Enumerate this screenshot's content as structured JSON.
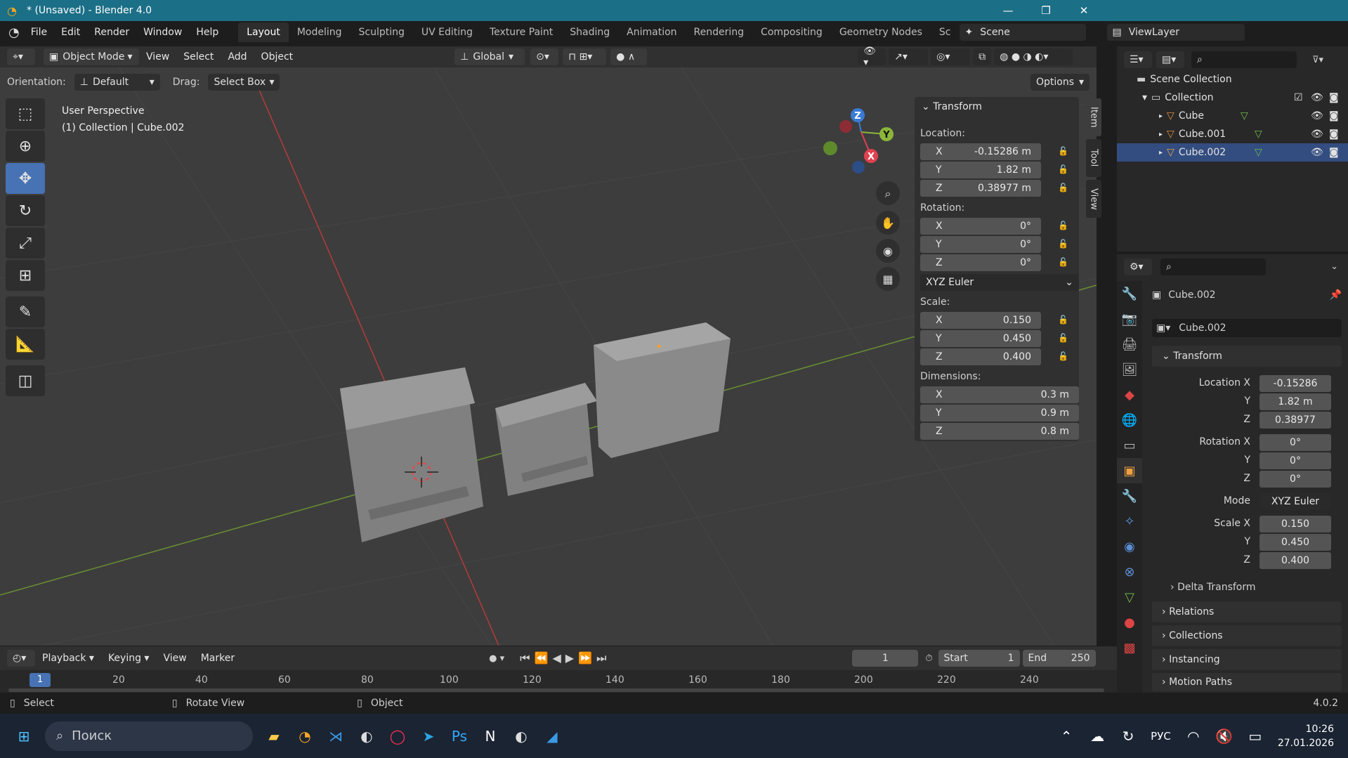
{
  "window": {
    "title": "* (Unsaved) - Blender 4.0",
    "minimize": "—",
    "maximize": "❐",
    "close": "✕"
  },
  "menu": [
    "File",
    "Edit",
    "Render",
    "Window",
    "Help"
  ],
  "workspaces": [
    "Layout",
    "Modeling",
    "Sculpting",
    "UV Editing",
    "Texture Paint",
    "Shading",
    "Animation",
    "Rendering",
    "Compositing",
    "Geometry Nodes",
    "Sc"
  ],
  "scene": {
    "name": "Scene",
    "view_layer": "ViewLayer"
  },
  "viewport_header": {
    "mode": "Object Mode",
    "view": "View",
    "select": "Select",
    "add": "Add",
    "object": "Object",
    "transform_orientation": "Global"
  },
  "tool_settings": {
    "orientation_label": "Orientation:",
    "orientation": "Default",
    "drag_label": "Drag:",
    "drag": "Select Box",
    "options": "Options"
  },
  "viewport_info": {
    "line1": "User Perspective",
    "line2": "(1) Collection | Cube.002"
  },
  "gizmo": {
    "x": "X",
    "y": "Y",
    "z": "Z"
  },
  "npanel": {
    "title": "Transform",
    "location_label": "Location:",
    "location": {
      "x": "-0.15286 m",
      "y": "1.82 m",
      "z": "0.38977 m"
    },
    "rotation_label": "Rotation:",
    "rotation": {
      "x": "0°",
      "y": "0°",
      "z": "0°"
    },
    "rotation_mode": "XYZ Euler",
    "scale_label": "Scale:",
    "scale": {
      "x": "0.150",
      "y": "0.450",
      "z": "0.400"
    },
    "dimensions_label": "Dimensions:",
    "dimensions": {
      "x": "0.3 m",
      "y": "0.9 m",
      "z": "0.8 m"
    },
    "axis": {
      "x": "X",
      "y": "Y",
      "z": "Z"
    },
    "tabs": [
      "Item",
      "Tool",
      "View"
    ]
  },
  "outliner": {
    "scene_collection": "Scene Collection",
    "collection": "Collection",
    "objects": [
      "Cube",
      "Cube.001",
      "Cube.002"
    ]
  },
  "properties": {
    "object_name": "Cube.002",
    "datablock": "Cube.002",
    "transform_title": "Transform",
    "labels": {
      "location_x": "Location X",
      "y": "Y",
      "z": "Z",
      "rotation_x": "Rotation X",
      "mode": "Mode",
      "scale_x": "Scale X"
    },
    "location": {
      "x": "-0.15286",
      "y": "1.82 m",
      "z": "0.38977"
    },
    "rotation": {
      "x": "0°",
      "y": "0°",
      "z": "0°"
    },
    "mode": "XYZ Euler",
    "scale": {
      "x": "0.150",
      "y": "0.450",
      "z": "0.400"
    },
    "subpanels": [
      "Delta Transform",
      "Relations",
      "Collections",
      "Instancing",
      "Motion Paths"
    ]
  },
  "timeline": {
    "playback": "Playback",
    "keying": "Keying",
    "view": "View",
    "marker": "Marker",
    "current_frame": "1",
    "start_label": "Start",
    "start": "1",
    "end_label": "End",
    "end": "250",
    "ticks": [
      "20",
      "40",
      "60",
      "80",
      "100",
      "120",
      "140",
      "160",
      "180",
      "200",
      "220",
      "240"
    ],
    "playhead": "1"
  },
  "statusbar": {
    "select": "Select",
    "rotate": "Rotate View",
    "object": "Object",
    "version": "4.0.2"
  },
  "taskbar": {
    "search": "Поиск",
    "lang": "РУС",
    "time": "10:26",
    "date": "27.01.2026"
  }
}
